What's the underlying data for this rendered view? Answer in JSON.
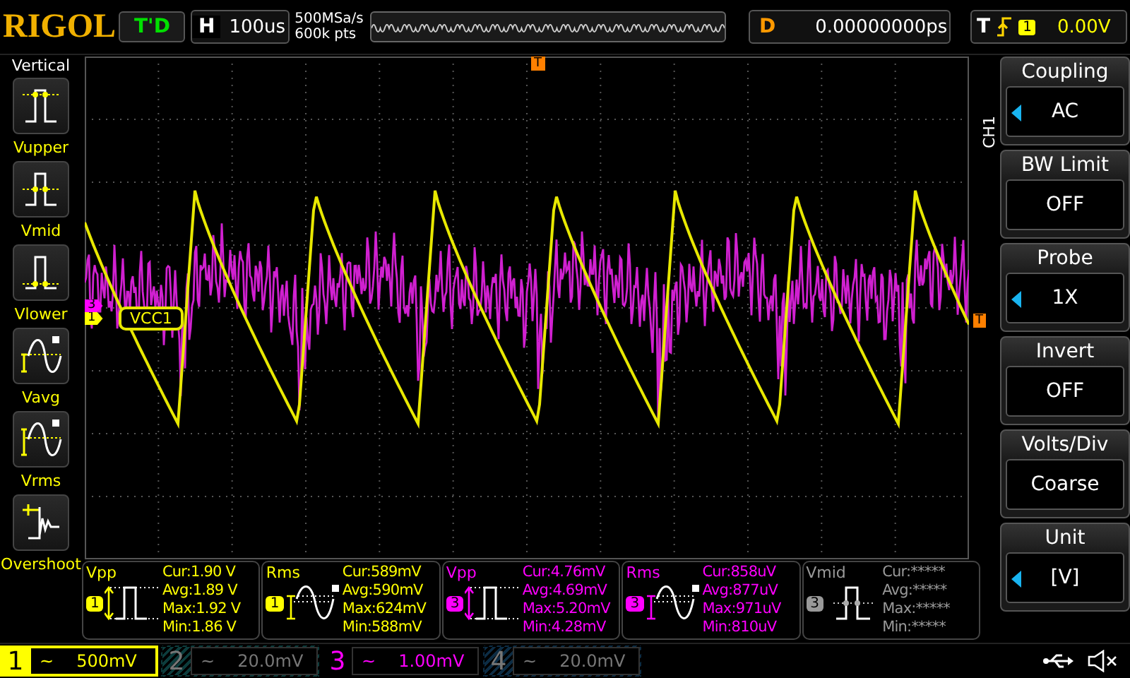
{
  "top_bar": {
    "brand": "RIGOL",
    "run_status": "T'D",
    "timebase": {
      "label": "H",
      "value": "100us"
    },
    "sample_rate": "500MSa/s",
    "memory_depth": "600k pts",
    "delay": {
      "label": "D",
      "value": "0.00000000ps"
    },
    "trigger": {
      "label": "T",
      "channel": "1",
      "level": "0.00V"
    }
  },
  "left_menu": {
    "title": "Vertical",
    "items": [
      {
        "label": "Vupper",
        "kind": "vupper"
      },
      {
        "label": "Vmid",
        "kind": "vmid"
      },
      {
        "label": "Vlower",
        "kind": "vlower"
      },
      {
        "label": "Vavg",
        "kind": "vavg"
      },
      {
        "label": "Vrms",
        "kind": "vrms"
      },
      {
        "label": "Overshoot",
        "kind": "overshoot"
      }
    ]
  },
  "plot": {
    "trigger_marker": "T",
    "level_marker": "T",
    "channel_markers": [
      {
        "number": "3",
        "color": "#ff00ff"
      },
      {
        "number": "1",
        "color": "#ffff00"
      }
    ],
    "trace_label": "VCC1"
  },
  "right_menu": {
    "channel": "CH1",
    "items": [
      {
        "title": "Coupling",
        "value": "AC",
        "arrow": true
      },
      {
        "title": "BW Limit",
        "value": "OFF",
        "arrow": false
      },
      {
        "title": "Probe",
        "value": "1X",
        "arrow": true
      },
      {
        "title": "Invert",
        "value": "OFF",
        "arrow": false
      },
      {
        "title": "Volts/Div",
        "value": "Coarse",
        "arrow": false
      },
      {
        "title": "Unit",
        "value": "[V]",
        "arrow": true
      }
    ]
  },
  "measurements": [
    {
      "name": "Vpp",
      "channel": "1",
      "color": "#ffff00",
      "kind": "vpp",
      "rows": [
        {
          "label": "Cur:",
          "value": "1.90 V"
        },
        {
          "label": "Avg:",
          "value": "1.89 V"
        },
        {
          "label": "Max:",
          "value": "1.92 V"
        },
        {
          "label": "Min:",
          "value": "1.86 V"
        }
      ]
    },
    {
      "name": "Rms",
      "channel": "1",
      "color": "#ffff00",
      "kind": "rms",
      "rows": [
        {
          "label": "Cur:",
          "value": "589mV"
        },
        {
          "label": "Avg:",
          "value": "590mV"
        },
        {
          "label": "Max:",
          "value": "624mV"
        },
        {
          "label": "Min:",
          "value": "588mV"
        }
      ]
    },
    {
      "name": "Vpp",
      "channel": "3",
      "color": "#ff00ff",
      "kind": "vpp",
      "rows": [
        {
          "label": "Cur:",
          "value": "4.76mV"
        },
        {
          "label": "Avg:",
          "value": "4.69mV"
        },
        {
          "label": "Max:",
          "value": "5.20mV"
        },
        {
          "label": "Min:",
          "value": "4.28mV"
        }
      ]
    },
    {
      "name": "Rms",
      "channel": "3",
      "color": "#ff00ff",
      "kind": "rms",
      "rows": [
        {
          "label": "Cur:",
          "value": "858uV"
        },
        {
          "label": "Avg:",
          "value": "877uV"
        },
        {
          "label": "Max:",
          "value": "971uV"
        },
        {
          "label": "Min:",
          "value": "810uV"
        }
      ]
    },
    {
      "name": "Vmid",
      "channel": "3",
      "color": "#999999",
      "kind": "vmid",
      "rows": [
        {
          "label": "Cur:",
          "value": "*****"
        },
        {
          "label": "Avg:",
          "value": "*****"
        },
        {
          "label": "Max:",
          "value": "*****"
        },
        {
          "label": "Min:",
          "value": "*****"
        }
      ]
    }
  ],
  "channels": [
    {
      "number": "1",
      "coupling": "~",
      "scale": "500mV",
      "selected": true,
      "enabled": true,
      "color": "#ffff00"
    },
    {
      "number": "2",
      "coupling": "~",
      "scale": "20.0mV",
      "selected": false,
      "enabled": false,
      "color": "#0c3c3c"
    },
    {
      "number": "3",
      "coupling": "~",
      "scale": "1.00mV",
      "selected": false,
      "enabled": true,
      "color": "#ff00ff"
    },
    {
      "number": "4",
      "coupling": "~",
      "scale": "20.0mV",
      "selected": false,
      "enabled": false,
      "color": "#0c2c44"
    }
  ]
}
